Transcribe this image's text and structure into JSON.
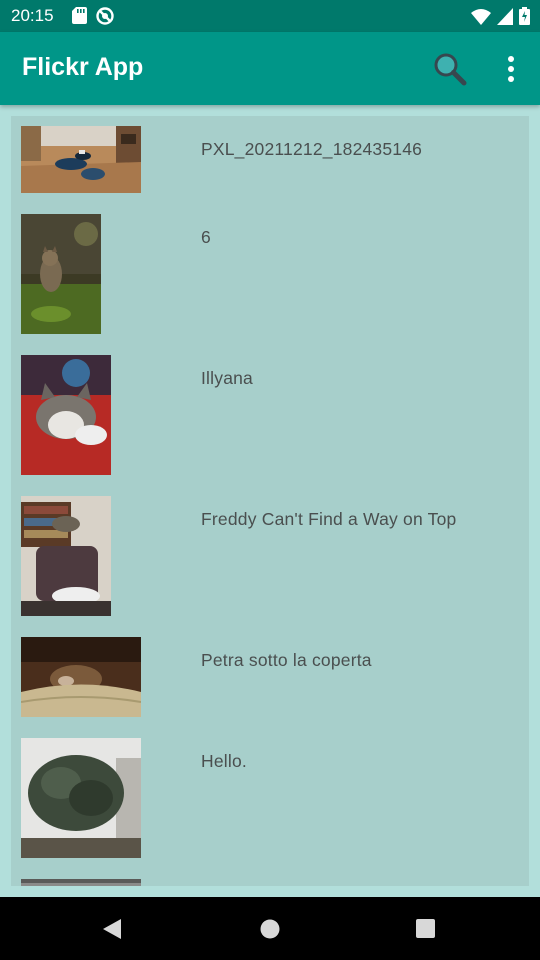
{
  "status_bar": {
    "time": "20:15",
    "left_icons": [
      "sd-card-icon",
      "do-not-disturb-icon"
    ],
    "right_icons": [
      "wifi-icon",
      "cell-signal-icon",
      "battery-icon"
    ]
  },
  "app_bar": {
    "title": "Flickr App",
    "actions": [
      "search-icon",
      "more-vertical-icon"
    ]
  },
  "photos": [
    {
      "title": "PXL_20211212_182435146"
    },
    {
      "title": "6"
    },
    {
      "title": "Illyana"
    },
    {
      "title": "Freddy Can't Find a Way on Top"
    },
    {
      "title": "Petra sotto la coperta"
    },
    {
      "title": "Hello."
    },
    {
      "title": ""
    }
  ],
  "navigation": [
    "back-icon",
    "home-icon",
    "recents-icon"
  ],
  "colors": {
    "status_bar": "#00796b",
    "app_bar": "#009688",
    "background": "#b2dfdb",
    "list_panel": "#a7cfcb",
    "title_text": "#4a4f4f"
  }
}
